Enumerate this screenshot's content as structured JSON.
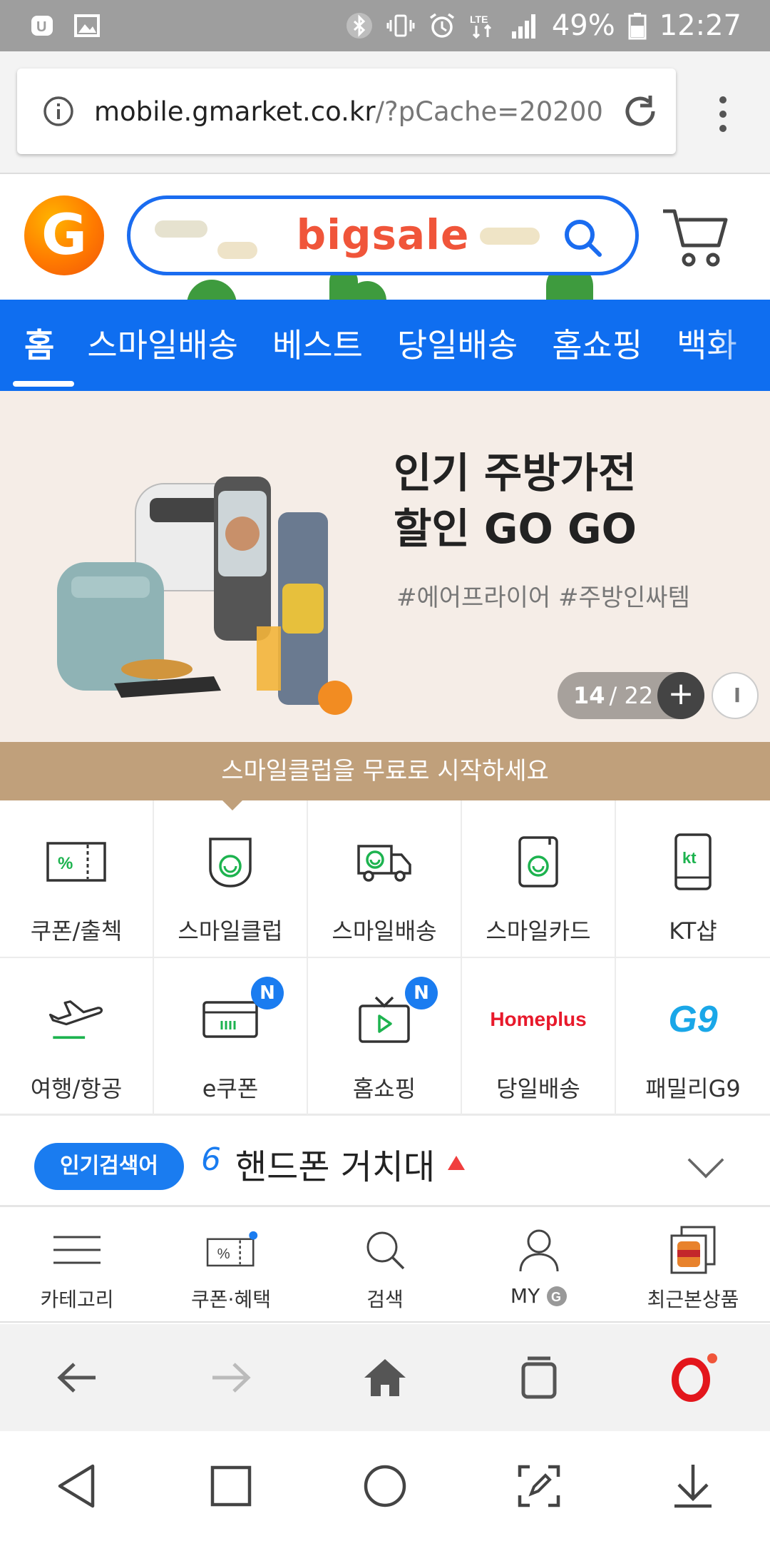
{
  "status_bar": {
    "battery": "49%",
    "time": "12:27"
  },
  "browser": {
    "url_main": "mobile.gmarket.co.kr",
    "url_rest": "/?pCache=20200"
  },
  "header": {
    "logo": "G",
    "search_text": "bigsale"
  },
  "nav": {
    "tabs": [
      "홈",
      "스마일배송",
      "베스트",
      "당일배송",
      "홈쇼핑",
      "백화"
    ]
  },
  "banner": {
    "title_line1": "인기 주방가전",
    "title_line2": "할인 GO GO",
    "hashtags": "#에어프라이어 #주방인싸템",
    "pager_current": "14",
    "pager_total": "/ 22",
    "plus_icon": "+",
    "pause_icon": "II"
  },
  "smileclub_bar": {
    "text": "스마일클럽을 무료로 시작하세요"
  },
  "shortcuts": [
    {
      "label": "쿠폰/출첵",
      "icon": "coupon-icon"
    },
    {
      "label": "스마일클럽",
      "icon": "smileclub-icon"
    },
    {
      "label": "스마일배송",
      "icon": "delivery-truck-icon"
    },
    {
      "label": "스마일카드",
      "icon": "card-icon"
    },
    {
      "label": "KT샵",
      "icon": "kt-phone-icon",
      "icon_text": "kt"
    },
    {
      "label": "여행/항공",
      "icon": "airplane-icon"
    },
    {
      "label": "e쿠폰",
      "icon": "ecoupon-icon",
      "badge": "N"
    },
    {
      "label": "홈쇼핑",
      "icon": "tv-icon",
      "badge": "N"
    },
    {
      "label": "당일배송",
      "icon": "homeplus-logo",
      "icon_text": "Homeplus"
    },
    {
      "label": "패밀리G9",
      "icon": "g9-logo",
      "icon_text": "G9"
    }
  ],
  "popular": {
    "badge": "인기검색어",
    "rank": "6",
    "keyword": "핸드폰 거치대"
  },
  "app_bar": [
    {
      "label": "카테고리",
      "icon": "menu-icon"
    },
    {
      "label": "쿠폰·혜택",
      "icon": "coupon-icon"
    },
    {
      "label": "검색",
      "icon": "search-icon"
    },
    {
      "label": "MY",
      "icon": "user-icon"
    },
    {
      "label": "최근본상품",
      "icon": "recent-items-icon"
    }
  ],
  "colors": {
    "brand_blue": "#0f6ef0",
    "gold": "#c0a07b",
    "accent_red": "#f0553a"
  }
}
